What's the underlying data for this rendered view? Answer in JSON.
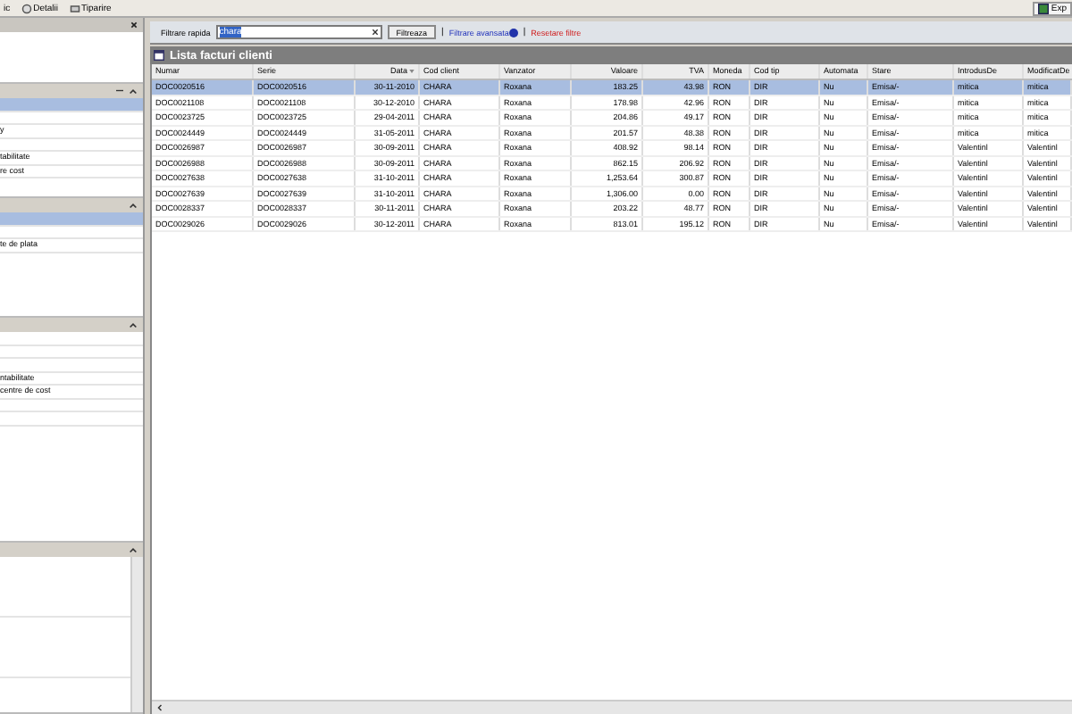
{
  "toolbar": {
    "items": [
      {
        "label": "ic"
      },
      {
        "label": "Detalii"
      },
      {
        "label": "Tiparire"
      }
    ],
    "export_label": "Exp"
  },
  "left_panel": {
    "sections": [
      {
        "kind": "top"
      },
      {
        "kind": "group",
        "items": [
          {
            "selected": true
          },
          {
            "selected": false
          },
          {
            "selected": false,
            "text": "y"
          },
          {
            "selected": false
          },
          {
            "selected": false,
            "text": "tabilitate"
          },
          {
            "selected": false,
            "text": "re cost"
          }
        ]
      },
      {
        "kind": "group",
        "items": [
          {
            "selected": true
          },
          {
            "selected": false
          },
          {
            "selected": false,
            "text": "te de plata"
          }
        ]
      },
      {
        "kind": "group",
        "items": [
          {
            "selected": false
          },
          {
            "selected": false
          },
          {
            "selected": false
          },
          {
            "selected": false,
            "text": "ntabilitate"
          },
          {
            "selected": false,
            "text": "centre de cost"
          },
          {
            "selected": false
          },
          {
            "selected": false
          }
        ]
      },
      {
        "kind": "list",
        "items": [
          {
            "selected": false
          },
          {
            "selected": false
          }
        ]
      }
    ]
  },
  "filter": {
    "label": "Filtrare rapida",
    "value": "chara",
    "button": "Filtreaza",
    "separator": "|",
    "advanced": "Filtrare avansata",
    "reset": "Resetare filtre"
  },
  "table": {
    "title": "Lista facturi clienti",
    "columns": [
      {
        "label": "Numar",
        "kind": "text"
      },
      {
        "label": "Serie",
        "kind": "text"
      },
      {
        "label": "Data",
        "kind": "number",
        "sorted": true
      },
      {
        "label": "Cod client",
        "kind": "text"
      },
      {
        "label": "Vanzator",
        "kind": "text"
      },
      {
        "label": "Valoare",
        "kind": "number"
      },
      {
        "label": "TVA",
        "kind": "number"
      },
      {
        "label": "Moneda",
        "kind": "text"
      },
      {
        "label": "Cod tip",
        "kind": "text"
      },
      {
        "label": "Automata",
        "kind": "text"
      },
      {
        "label": "Stare",
        "kind": "text"
      },
      {
        "label": "IntrodusDe",
        "kind": "text"
      },
      {
        "label": "ModificatDe",
        "kind": "text"
      }
    ],
    "rows": [
      {
        "selected": true,
        "cells": [
          "DOC0020516",
          "DOC0020516",
          "30-11-2010",
          "CHARA",
          "Roxana",
          "183.25",
          "43.98",
          "RON",
          "DIR",
          "Nu",
          "Emisa/-",
          "mitica",
          "mitica"
        ]
      },
      {
        "selected": false,
        "cells": [
          "DOC0021108",
          "DOC0021108",
          "30-12-2010",
          "CHARA",
          "Roxana",
          "178.98",
          "42.96",
          "RON",
          "DIR",
          "Nu",
          "Emisa/-",
          "mitica",
          "mitica"
        ]
      },
      {
        "selected": false,
        "cells": [
          "DOC0023725",
          "DOC0023725",
          "29-04-2011",
          "CHARA",
          "Roxana",
          "204.86",
          "49.17",
          "RON",
          "DIR",
          "Nu",
          "Emisa/-",
          "mitica",
          "mitica"
        ]
      },
      {
        "selected": false,
        "cells": [
          "DOC0024449",
          "DOC0024449",
          "31-05-2011",
          "CHARA",
          "Roxana",
          "201.57",
          "48.38",
          "RON",
          "DIR",
          "Nu",
          "Emisa/-",
          "mitica",
          "mitica"
        ]
      },
      {
        "selected": false,
        "cells": [
          "DOC0026987",
          "DOC0026987",
          "30-09-2011",
          "CHARA",
          "Roxana",
          "408.92",
          "98.14",
          "RON",
          "DIR",
          "Nu",
          "Emisa/-",
          "Valentinl",
          "Valentinl"
        ]
      },
      {
        "selected": false,
        "cells": [
          "DOC0026988",
          "DOC0026988",
          "30-09-2011",
          "CHARA",
          "Roxana",
          "862.15",
          "206.92",
          "RON",
          "DIR",
          "Nu",
          "Emisa/-",
          "Valentinl",
          "Valentinl"
        ]
      },
      {
        "selected": false,
        "cells": [
          "DOC0027638",
          "DOC0027638",
          "31-10-2011",
          "CHARA",
          "Roxana",
          "1,253.64",
          "300.87",
          "RON",
          "DIR",
          "Nu",
          "Emisa/-",
          "Valentinl",
          "Valentinl"
        ]
      },
      {
        "selected": false,
        "cells": [
          "DOC0027639",
          "DOC0027639",
          "31-10-2011",
          "CHARA",
          "Roxana",
          "1,306.00",
          "0.00",
          "RON",
          "DIR",
          "Nu",
          "Emisa/-",
          "Valentinl",
          "Valentinl"
        ]
      },
      {
        "selected": false,
        "cells": [
          "DOC0028337",
          "DOC0028337",
          "30-11-2011",
          "CHARA",
          "Roxana",
          "203.22",
          "48.77",
          "RON",
          "DIR",
          "Nu",
          "Emisa/-",
          "Valentinl",
          "Valentinl"
        ]
      },
      {
        "selected": false,
        "cells": [
          "DOC0029026",
          "DOC0029026",
          "30-12-2011",
          "CHARA",
          "Roxana",
          "813.01",
          "195.12",
          "RON",
          "DIR",
          "Nu",
          "Emisa/-",
          "Valentinl",
          "Valentinl"
        ]
      }
    ]
  }
}
